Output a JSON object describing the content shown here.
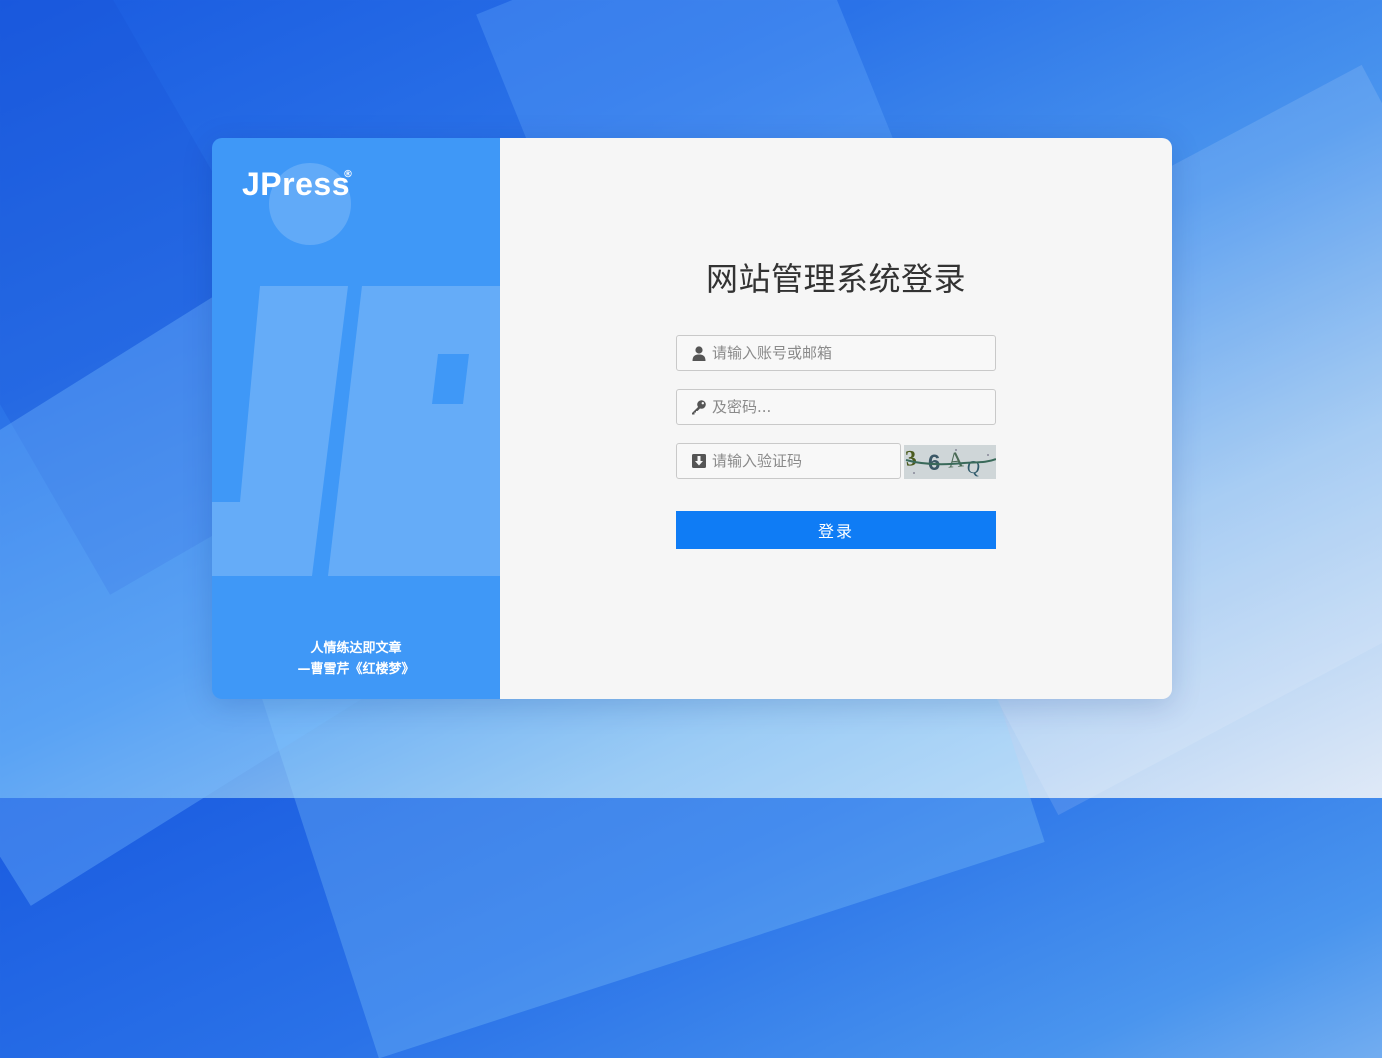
{
  "brand": {
    "logo_text": "JPress",
    "registered_mark": "®"
  },
  "quote": {
    "line1": "人情练达即文章",
    "line2": "—曹雪芹《红楼梦》"
  },
  "login": {
    "title": "网站管理系统登录",
    "account_placeholder": "请输入账号或邮箱",
    "password_placeholder": "及密码...",
    "captcha_placeholder": "请输入验证码",
    "captcha_text": "36AQ",
    "submit_label": "登录"
  },
  "icons": {
    "account": "user-icon",
    "password": "key-icon",
    "captcha": "download-icon",
    "captcha_image": "captcha-image"
  },
  "colors": {
    "panel_blue": "#3f98f7",
    "button_blue": "#0f7cf5",
    "form_background": "#f6f6f6"
  }
}
